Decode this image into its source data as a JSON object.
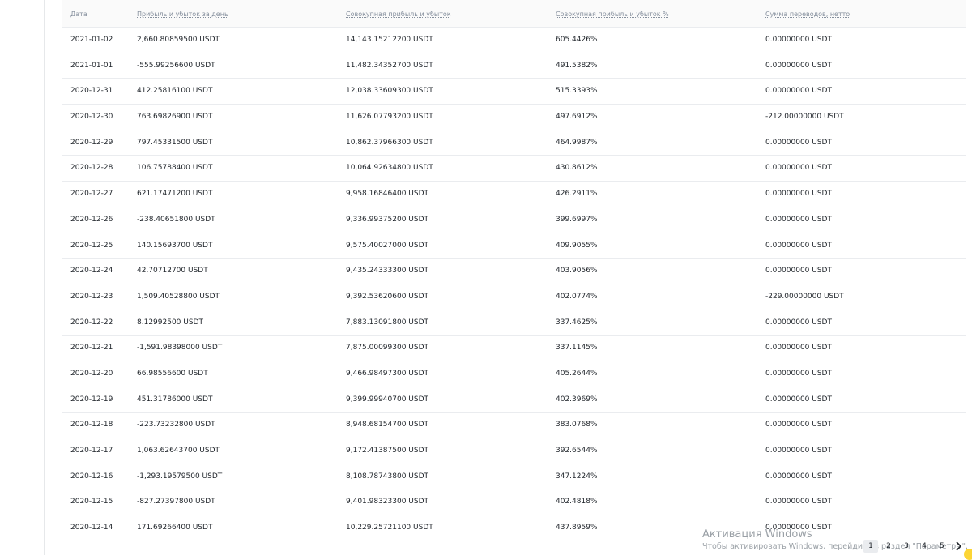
{
  "headers": {
    "date": "Дата",
    "daily": "Прибыль и убыток за день",
    "cumulative": "Совокупная прибыль и убыток",
    "cumulative_pct": "Совокупная прибыль и убыток %",
    "net_transfer": "Сумма переводов, нетто"
  },
  "rows": [
    {
      "date": "2021-01-02",
      "daily": "2,660.80859500 USDT",
      "cum": "14,143.15212200 USDT",
      "pct": "605.4426%",
      "net": "0.00000000 USDT"
    },
    {
      "date": "2021-01-01",
      "daily": "-555.99256600 USDT",
      "cum": "11,482.34352700 USDT",
      "pct": "491.5382%",
      "net": "0.00000000 USDT"
    },
    {
      "date": "2020-12-31",
      "daily": "412.25816100 USDT",
      "cum": "12,038.33609300 USDT",
      "pct": "515.3393%",
      "net": "0.00000000 USDT"
    },
    {
      "date": "2020-12-30",
      "daily": "763.69826900 USDT",
      "cum": "11,626.07793200 USDT",
      "pct": "497.6912%",
      "net": "-212.00000000 USDT"
    },
    {
      "date": "2020-12-29",
      "daily": "797.45331500 USDT",
      "cum": "10,862.37966300 USDT",
      "pct": "464.9987%",
      "net": "0.00000000 USDT"
    },
    {
      "date": "2020-12-28",
      "daily": "106.75788400 USDT",
      "cum": "10,064.92634800 USDT",
      "pct": "430.8612%",
      "net": "0.00000000 USDT"
    },
    {
      "date": "2020-12-27",
      "daily": "621.17471200 USDT",
      "cum": "9,958.16846400 USDT",
      "pct": "426.2911%",
      "net": "0.00000000 USDT"
    },
    {
      "date": "2020-12-26",
      "daily": "-238.40651800 USDT",
      "cum": "9,336.99375200 USDT",
      "pct": "399.6997%",
      "net": "0.00000000 USDT"
    },
    {
      "date": "2020-12-25",
      "daily": "140.15693700 USDT",
      "cum": "9,575.40027000 USDT",
      "pct": "409.9055%",
      "net": "0.00000000 USDT"
    },
    {
      "date": "2020-12-24",
      "daily": "42.70712700 USDT",
      "cum": "9,435.24333300 USDT",
      "pct": "403.9056%",
      "net": "0.00000000 USDT"
    },
    {
      "date": "2020-12-23",
      "daily": "1,509.40528800 USDT",
      "cum": "9,392.53620600 USDT",
      "pct": "402.0774%",
      "net": "-229.00000000 USDT"
    },
    {
      "date": "2020-12-22",
      "daily": "8.12992500 USDT",
      "cum": "7,883.13091800 USDT",
      "pct": "337.4625%",
      "net": "0.00000000 USDT"
    },
    {
      "date": "2020-12-21",
      "daily": "-1,591.98398000 USDT",
      "cum": "7,875.00099300 USDT",
      "pct": "337.1145%",
      "net": "0.00000000 USDT"
    },
    {
      "date": "2020-12-20",
      "daily": "66.98556600 USDT",
      "cum": "9,466.98497300 USDT",
      "pct": "405.2644%",
      "net": "0.00000000 USDT"
    },
    {
      "date": "2020-12-19",
      "daily": "451.31786000 USDT",
      "cum": "9,399.99940700 USDT",
      "pct": "402.3969%",
      "net": "0.00000000 USDT"
    },
    {
      "date": "2020-12-18",
      "daily": "-223.73232800 USDT",
      "cum": "8,948.68154700 USDT",
      "pct": "383.0768%",
      "net": "0.00000000 USDT"
    },
    {
      "date": "2020-12-17",
      "daily": "1,063.62643700 USDT",
      "cum": "9,172.41387500 USDT",
      "pct": "392.6544%",
      "net": "0.00000000 USDT"
    },
    {
      "date": "2020-12-16",
      "daily": "-1,293.19579500 USDT",
      "cum": "8,108.78743800 USDT",
      "pct": "347.1224%",
      "net": "0.00000000 USDT"
    },
    {
      "date": "2020-12-15",
      "daily": "-827.27397800 USDT",
      "cum": "9,401.98323300 USDT",
      "pct": "402.4818%",
      "net": "0.00000000 USDT"
    },
    {
      "date": "2020-12-14",
      "daily": "171.69266400 USDT",
      "cum": "10,229.25721100 USDT",
      "pct": "437.8959%",
      "net": "0.00000000 USDT"
    }
  ],
  "watermark": {
    "title": "Активация Windows",
    "subtitle": "Чтобы активировать Windows, перейдите в раздел \"Параметры\"."
  },
  "pagination": {
    "pages": [
      "1",
      "2",
      "3",
      "4",
      "5"
    ],
    "active": "1",
    "next_icon": "chevron-right-icon"
  },
  "colors": {
    "accent": "#fcd535",
    "border": "#eaecef",
    "header_text": "#848e9c",
    "text": "#1e2329"
  }
}
